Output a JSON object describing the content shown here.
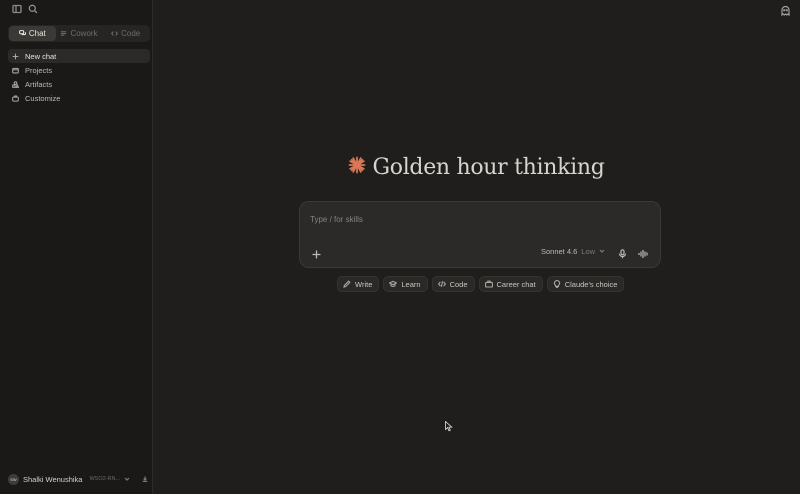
{
  "sidebar": {
    "modes": [
      {
        "label": "Chat",
        "icon": "chat-bubbles-icon",
        "active": true
      },
      {
        "label": "Cowork",
        "icon": "tasks-icon",
        "active": false
      },
      {
        "label": "Code",
        "icon": "code-icon",
        "active": false
      }
    ],
    "nav": [
      {
        "label": "New chat",
        "icon": "plus-icon"
      },
      {
        "label": "Projects",
        "icon": "folder-icon"
      },
      {
        "label": "Artifacts",
        "icon": "shapes-icon"
      },
      {
        "label": "Customize",
        "icon": "briefcase-icon"
      }
    ],
    "user": {
      "initials": "SW",
      "name": "Shalki Wenushika",
      "org": "WSO2-RN..."
    }
  },
  "main": {
    "greeting": "Golden hour thinking",
    "composer": {
      "placeholder": "Type / for skills",
      "model": "Sonnet 4.6",
      "effort": "Low"
    },
    "chips": [
      {
        "label": "Write",
        "icon": "pencil-icon"
      },
      {
        "label": "Learn",
        "icon": "graduation-cap-icon"
      },
      {
        "label": "Code",
        "icon": "code-icon"
      },
      {
        "label": "Career chat",
        "icon": "briefcase-icon"
      },
      {
        "label": "Claude's choice",
        "icon": "lightbulb-icon"
      }
    ]
  },
  "colors": {
    "background": "#1f1e1d",
    "sidebar": "#1a1918",
    "accent": "#d97757"
  }
}
